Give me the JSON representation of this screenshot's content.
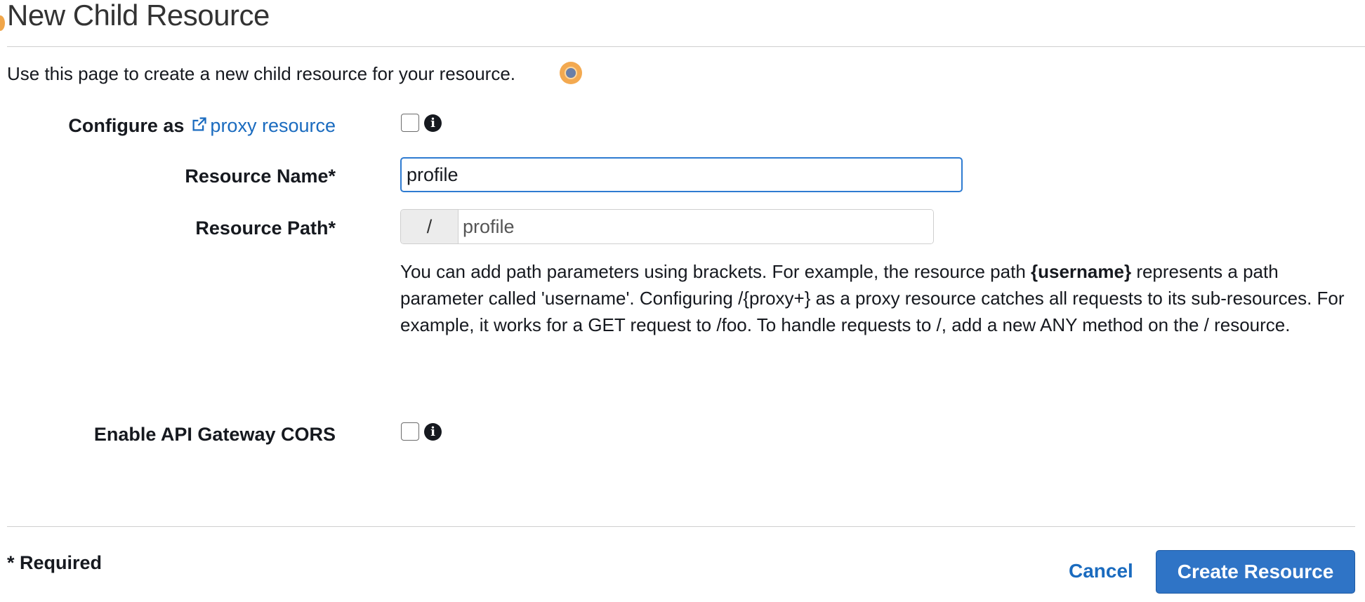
{
  "page": {
    "title": "New Child Resource",
    "intro": "Use this page to create a new child resource for your resource."
  },
  "form": {
    "proxy": {
      "label": "Configure as",
      "link_text": "proxy resource",
      "checked": false
    },
    "resource_name": {
      "label": "Resource Name*",
      "value": "profile"
    },
    "resource_path": {
      "label": "Resource Path*",
      "prefix": "/",
      "value": "profile"
    },
    "help": {
      "part1": "You can add path parameters using brackets. For example, the resource path ",
      "bold": "{username}",
      "part2": " represents a path parameter called 'username'. Configuring /{proxy+} as a proxy resource catches all requests to its sub-resources. For example, it works for a GET request to /foo. To handle requests to /, add a new ANY method on the / resource."
    },
    "cors": {
      "label": "Enable API Gateway CORS",
      "checked": false
    }
  },
  "footer": {
    "required_note": "* Required",
    "cancel_label": "Cancel",
    "create_label": "Create Resource"
  },
  "icons": {
    "info": "info-icon",
    "external_link": "external-link-icon"
  },
  "colors": {
    "primary": "#2f74c6",
    "link": "#1a6bbf",
    "focus_border": "#2e7bd1"
  }
}
